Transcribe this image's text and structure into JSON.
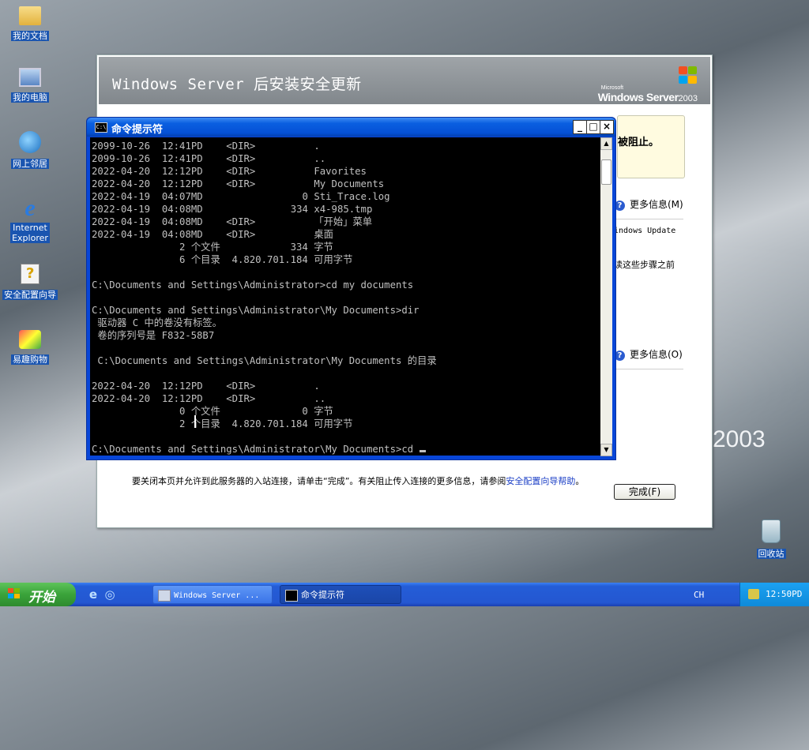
{
  "desktop": {
    "icons": [
      {
        "label": "我的文档",
        "icon": "my-documents-icon"
      },
      {
        "label": "我的电脑",
        "icon": "my-computer-icon"
      },
      {
        "label": "网上邻居",
        "icon": "network-places-icon"
      },
      {
        "label_line1": "Internet",
        "label_line2": "Explorer",
        "icon": "internet-explorer-icon"
      },
      {
        "label": "安全配置向导",
        "icon": "security-wizard-icon"
      },
      {
        "label": "易趣购物",
        "icon": "shopping-icon"
      },
      {
        "label": "回收站",
        "icon": "recycle-bin-icon"
      }
    ],
    "wallpaper_text": "2003"
  },
  "setup_window": {
    "title": "Windows Server 后安装安全更新",
    "logo": {
      "ms": "Microsoft",
      "product": "Windows Server",
      "year": "2003"
    },
    "warning_text": "被阻止。",
    "more_info_1": "更多信息(M)",
    "side_text_1": "indows Update",
    "side_text_2": "读这些步骤之前",
    "more_info_2": "更多信息(O)",
    "footer_text": "要关闭本页并允许到此服务器的入站连接，请单击“完成”。有关阻止传入连接的更多信息，请参阅",
    "footer_link": "安全配置向导帮助",
    "footer_end": "。",
    "finish_button": "完成(F)"
  },
  "cmd_window": {
    "title": "命令提示符",
    "icon_text": "C:\\",
    "lines": [
      "2099-10-26  12:41PD    <DIR>          .",
      "2099-10-26  12:41PD    <DIR>          ..",
      "2022-04-20  12:12PD    <DIR>          Favorites",
      "2022-04-20  12:12PD    <DIR>          My Documents",
      "2022-04-19  04:07MD                 0 Sti_Trace.log",
      "2022-04-19  04:08MD               334 x4-985.tmp",
      "2022-04-19  04:08MD    <DIR>          「开始」菜单",
      "2022-04-19  04:08MD    <DIR>          桌面",
      "               2 个文件            334 字节",
      "               6 个目录  4.820.701.184 可用字节",
      "",
      "C:\\Documents and Settings\\Administrator>cd my documents",
      "",
      "C:\\Documents and Settings\\Administrator\\My Documents>dir",
      " 驱动器 C 中的卷没有标签。",
      " 卷的序列号是 F832-58B7",
      "",
      " C:\\Documents and Settings\\Administrator\\My Documents 的目录",
      "",
      "2022-04-20  12:12PD    <DIR>          .",
      "2022-04-20  12:12PD    <DIR>          ..",
      "               0 个文件              0 字节",
      "               2 个目录  4.820.701.184 可用字节",
      "",
      "C:\\Documents and Settings\\Administrator\\My Documents>cd "
    ],
    "buttons": {
      "minimize": "_",
      "maximize": "□",
      "close": "×"
    }
  },
  "taskbar": {
    "start_label": "开始",
    "tasks": [
      {
        "label": "Windows Server ...",
        "active": false
      },
      {
        "label": "命令提示符",
        "active": true
      }
    ],
    "language": "CH",
    "clock": "12:50PD"
  }
}
